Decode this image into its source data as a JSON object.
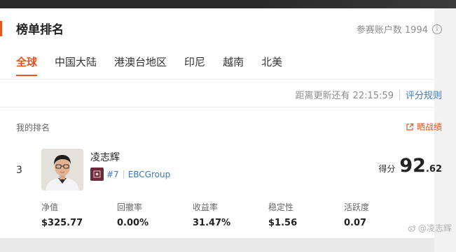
{
  "header": {
    "title": "榜单排名",
    "participants_label": "参赛账户数 1994",
    "info_icon": "i"
  },
  "tabs": [
    {
      "label": "全球",
      "active": true
    },
    {
      "label": "中国大陆",
      "active": false
    },
    {
      "label": "港澳台地区",
      "active": false
    },
    {
      "label": "印尼",
      "active": false
    },
    {
      "label": "越南",
      "active": false
    },
    {
      "label": "北美",
      "active": false
    }
  ],
  "update": {
    "countdown": "距离更新还有 22:15:59",
    "rules_link": "评分规则"
  },
  "my_rank": {
    "section_label": "我的排名",
    "share_label": "晒战绩",
    "rank": "3",
    "name": "凌志辉",
    "user_id": "#7",
    "group": "EBCGroup",
    "score_label": "得分",
    "score_int": "92",
    "score_dec": ".62",
    "metrics": [
      {
        "label": "净值",
        "value": "$325.77"
      },
      {
        "label": "回撤率",
        "value": "0.00%"
      },
      {
        "label": "收益率",
        "value": "31.47%"
      },
      {
        "label": "稳定性",
        "value": "$1.56"
      },
      {
        "label": "活跃度",
        "value": "0.07"
      }
    ]
  },
  "watermark": "@凌志辉",
  "colors": {
    "accent": "#e8541e",
    "link": "#3a78c3",
    "flag": "#6a2a3a"
  },
  "icons": {
    "info": "info-circle-icon",
    "share": "share-external-icon",
    "flag": "group-flag-icon",
    "watermark": "weibo-icon"
  }
}
